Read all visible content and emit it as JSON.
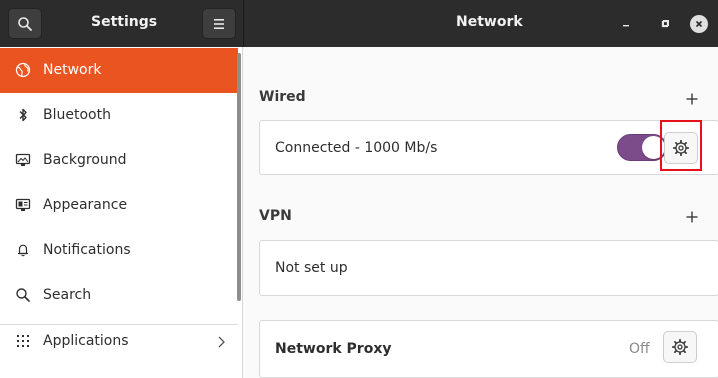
{
  "header": {
    "sidebar_title": "Settings",
    "main_title": "Network",
    "search_icon": "search-icon",
    "menu_icon": "hamburger-menu-icon"
  },
  "window_controls": {
    "minimize_icon": "minimize-icon",
    "maximize_icon": "maximize-icon",
    "close_icon": "close-icon"
  },
  "sidebar": {
    "items": [
      {
        "label": "Network",
        "icon": "globe-icon",
        "selected": true
      },
      {
        "label": "Bluetooth",
        "icon": "bluetooth-icon",
        "selected": false
      },
      {
        "label": "Background",
        "icon": "monitor-icon",
        "selected": false
      },
      {
        "label": "Appearance",
        "icon": "appearance-icon",
        "selected": false
      },
      {
        "label": "Notifications",
        "icon": "bell-icon",
        "selected": false
      },
      {
        "label": "Search",
        "icon": "search-icon",
        "selected": false
      },
      {
        "label": "Applications",
        "icon": "apps-grid-icon",
        "selected": false,
        "has_submenu": true
      }
    ]
  },
  "main": {
    "wired": {
      "title": "Wired",
      "connection_label": "Connected - 1000 Mb/s",
      "enabled": true
    },
    "vpn": {
      "title": "VPN",
      "status": "Not set up"
    },
    "proxy": {
      "title": "Network Proxy",
      "status": "Off"
    }
  },
  "colors": {
    "accent": "#e95420",
    "toggle_on": "#7c4c8a",
    "header_bg": "#2c2c2c",
    "highlight": "#e6121b"
  }
}
